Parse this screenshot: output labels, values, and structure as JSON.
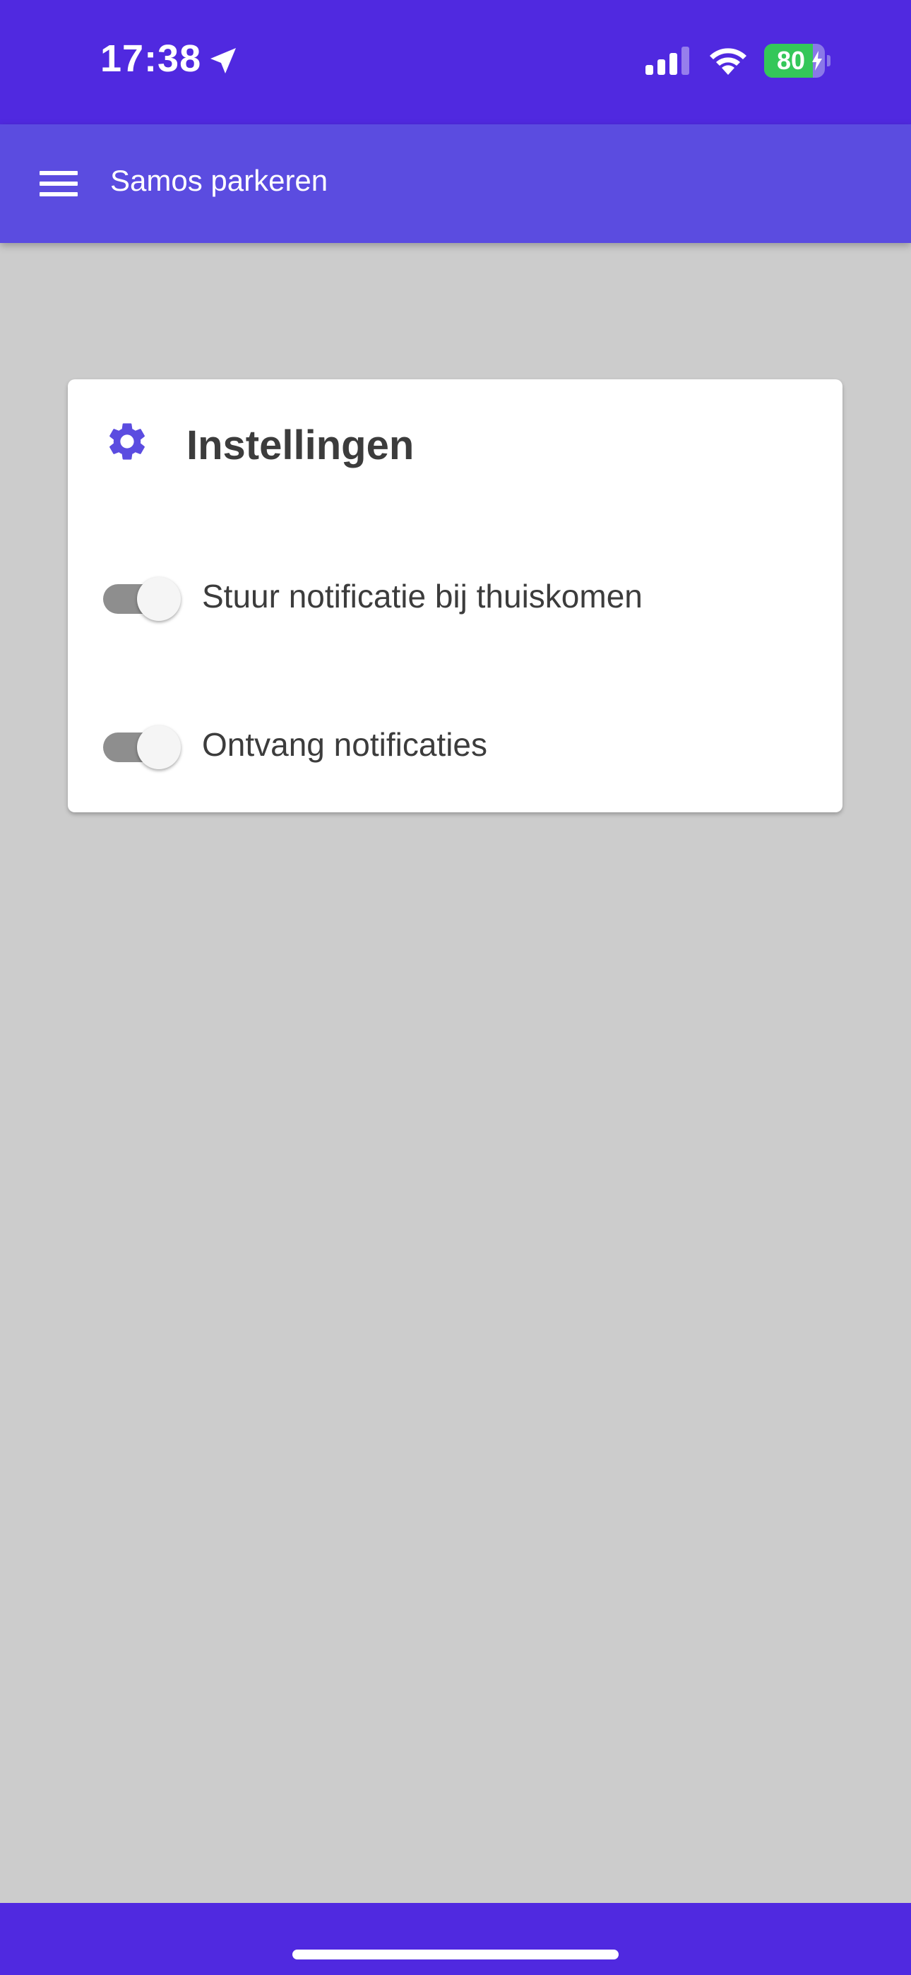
{
  "status_bar": {
    "time": "17:38",
    "battery_level": "80",
    "battery_percent": 80,
    "icons": [
      "location-arrow-icon",
      "signal-icon",
      "wifi-icon",
      "battery-charging-icon"
    ]
  },
  "app_bar": {
    "title": "Samos parkeren",
    "menu_icon": "hamburger-menu-icon"
  },
  "settings_card": {
    "icon": "gear-icon",
    "title": "Instellingen",
    "settings": [
      {
        "label": "Stuur notificatie bij thuiskomen",
        "enabled": false
      },
      {
        "label": "Ontvang notificaties",
        "enabled": false
      }
    ]
  },
  "colors": {
    "status_bar_bg": "#5029e0",
    "app_bar_bg": "#5b4ce0",
    "accent": "#5b4ce0",
    "background": "#cccccc",
    "toggle_off_track": "#8e8e8e",
    "battery_green": "#34c759"
  }
}
